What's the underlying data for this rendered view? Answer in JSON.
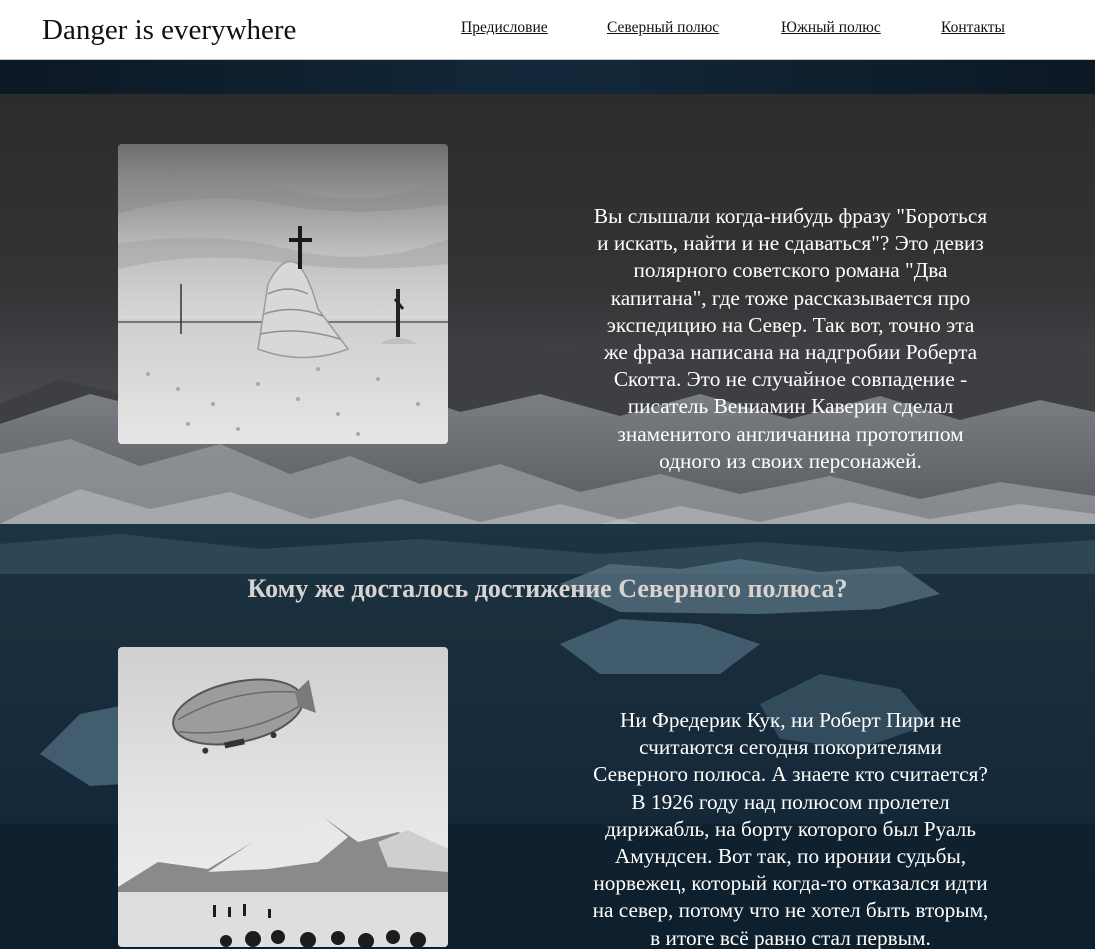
{
  "header": {
    "brand": "Danger is everywhere",
    "nav": [
      "Предисловие",
      "Северный полюс",
      "Южный полюс",
      "Контакты"
    ]
  },
  "section1": {
    "lines": [
      "Вы слышали когда-нибудь фразу \"Бороться",
      "и искать, найти и не сдаваться\"? Это девиз",
      "полярного советского романа \"Два",
      "капитана\", где тоже рассказывается про",
      "экспедицию на Север. Так вот, точно эта",
      "же фраза написана на надгробии Роберта",
      "Скотта. Это не случайное совпадение -",
      "писатель Вениамин Каверин сделал",
      "знаменитого англичанина прототипом",
      "одного из своих персонажей."
    ]
  },
  "section2": {
    "heading": "Кому же досталось достижение Северного полюса?",
    "lines": [
      "Ни Фредерик Кук, ни Роберт Пири не",
      "считаются сегодня покорителями",
      "Северного полюса. А знаете кто считается?",
      "В 1926 году над полюсом пролетел",
      "дирижабль, на борту которого был Руаль",
      "Амундсен. Вот так, по иронии судьбы,",
      "норвежец, который когда-то отказался идти",
      "на север, потому что не хотел быть вторым,",
      "в итоге всё равно стал первым."
    ]
  }
}
